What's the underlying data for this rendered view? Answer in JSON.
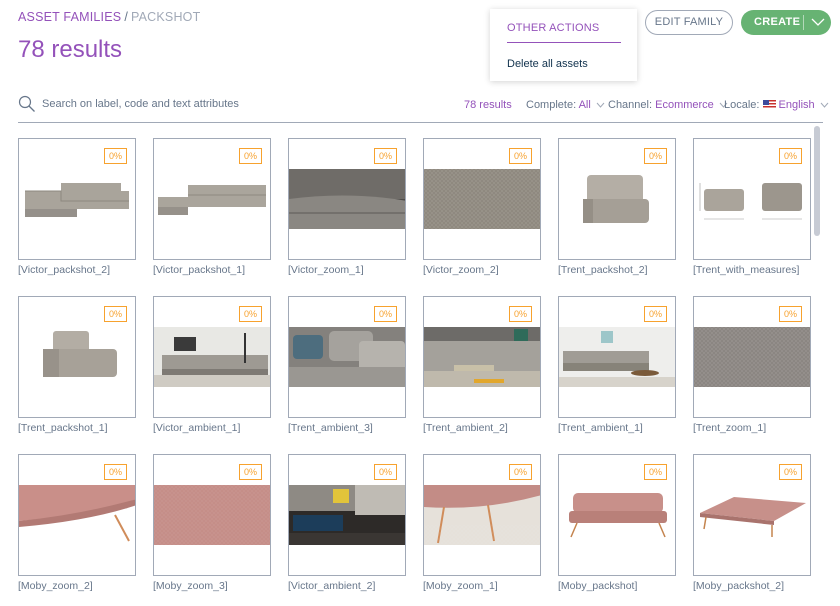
{
  "breadcrumb": {
    "parent": "ASSET FAMILIES",
    "separator": "/",
    "current": "PACKSHOT"
  },
  "page_title": "78 results",
  "other_actions": {
    "title": "OTHER ACTIONS",
    "items": [
      "Delete all assets"
    ]
  },
  "buttons": {
    "edit_family": "EDIT FAMILY",
    "create": "CREATE"
  },
  "search": {
    "placeholder": "Search on label, code and text attributes",
    "value": ""
  },
  "filters": {
    "result_count": "78 results",
    "complete_label": "Complete:",
    "complete_value": "All",
    "channel_label": "Channel:",
    "channel_value": "Ecommerce",
    "locale_label": "Locale:",
    "locale_value": "English"
  },
  "colors": {
    "accent": "#9452ba",
    "create": "#67b373",
    "badge": "#f7a22e",
    "border": "#a1a9b7",
    "text": "#67768a"
  },
  "assets": [
    {
      "label": "[Victor_packshot_2]",
      "completeness": "0%",
      "kind": "sofa-corner"
    },
    {
      "label": "[Victor_packshot_1]",
      "completeness": "0%",
      "kind": "sofa-long"
    },
    {
      "label": "[Victor_zoom_1]",
      "completeness": "0%",
      "kind": "zoom-gray-dark"
    },
    {
      "label": "[Victor_zoom_2]",
      "completeness": "0%",
      "kind": "texture-gray"
    },
    {
      "label": "[Trent_packshot_2]",
      "completeness": "0%",
      "kind": "chair-back"
    },
    {
      "label": "[Trent_with_measures]",
      "completeness": "0%",
      "kind": "measures"
    },
    {
      "label": "[Trent_packshot_1]",
      "completeness": "0%",
      "kind": "chair-side"
    },
    {
      "label": "[Victor_ambient_1]",
      "completeness": "0%",
      "kind": "room-gray"
    },
    {
      "label": "[Trent_ambient_3]",
      "completeness": "0%",
      "kind": "cushions-gray"
    },
    {
      "label": "[Trent_ambient_2]",
      "completeness": "0%",
      "kind": "room-corner"
    },
    {
      "label": "[Trent_ambient_1]",
      "completeness": "0%",
      "kind": "room-living"
    },
    {
      "label": "[Trent_zoom_1]",
      "completeness": "0%",
      "kind": "texture-gray2"
    },
    {
      "label": "[Moby_zoom_2]",
      "completeness": "0%",
      "kind": "pink-zoom-leg"
    },
    {
      "label": "[Moby_zoom_3]",
      "completeness": "0%",
      "kind": "pink-texture"
    },
    {
      "label": "[Victor_ambient_2]",
      "completeness": "0%",
      "kind": "room-dark"
    },
    {
      "label": "[Moby_zoom_1]",
      "completeness": "0%",
      "kind": "pink-rug"
    },
    {
      "label": "[Moby_packshot]",
      "completeness": "0%",
      "kind": "pink-sofa"
    },
    {
      "label": "[Moby_packshot_2]",
      "completeness": "0%",
      "kind": "pink-bed"
    }
  ]
}
